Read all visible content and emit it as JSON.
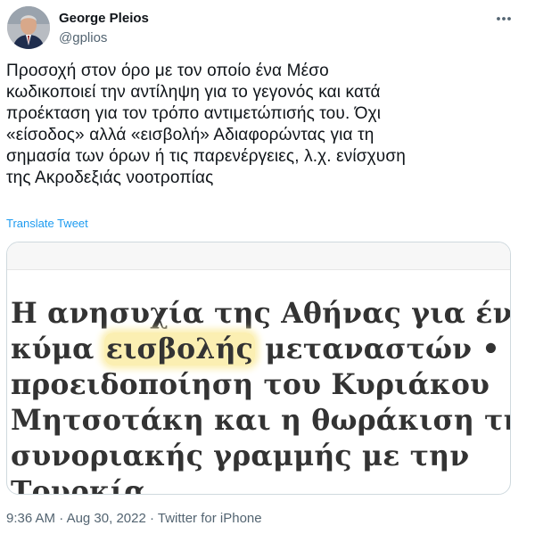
{
  "author": {
    "name": "George Pleios",
    "handle": "@gplios"
  },
  "tweet": {
    "text_lines": [
      "Προσοχή στον όρο με τον οποίο ένα Μέσο",
      "κωδικοποιεί την αντίληψη για το γεγονός και κατά",
      "προέκταση για τον τρόπο αντιμετώπισής του. Όχι",
      "«είσοδος» αλλά «εισβολή» Αδιαφορώντας για τη",
      "σημασία των όρων ή τις παρενέργειες, λ.χ. ενίσχυση",
      "της Ακροδεξιάς νοοτροπίας"
    ],
    "translate_label": "Translate Tweet"
  },
  "media": {
    "line1": "Η ανησυχία της Αθήνας για ένα νέ",
    "line2_before": "κύμα ",
    "line2_highlight": "εισβολής",
    "line2_after": " μεταναστών • Η",
    "line3": "προειδοποίηση του Κυριάκου",
    "line4": "Μητσοτάκη και η θωράκιση της",
    "line5": "συνοριακής γραμμής με την",
    "line6": "Τουρκία.",
    "highlight_color": "#fbefb2"
  },
  "meta": {
    "time": "9:36 AM",
    "sep1": " · ",
    "date": "Aug 30, 2022",
    "sep2": " · ",
    "source": "Twitter for iPhone"
  },
  "icons": {
    "more": "more-dots-icon",
    "avatar": "profile-photo"
  },
  "colors": {
    "link": "#1d9bf0",
    "secondary_text": "#536471",
    "primary_text": "#0f1419"
  }
}
